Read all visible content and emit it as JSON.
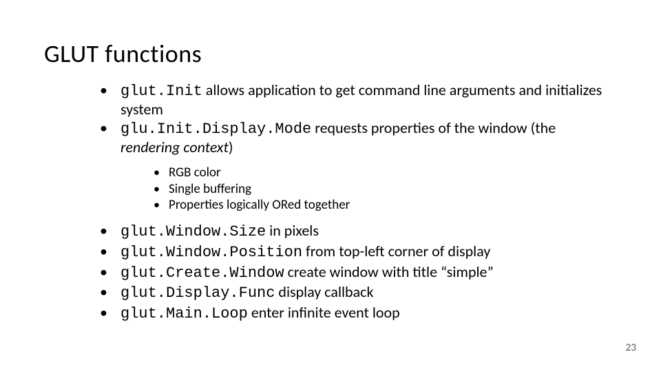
{
  "title": "GLUT functions",
  "items": [
    {
      "code": "glut.Init",
      "text_after": "  allows application to get command line arguments and initializes system"
    },
    {
      "code": "glu.Init.Display.Mode",
      "text_after": "  requests properties of the window (the ",
      "italic": "rendering context",
      "text_end": ")",
      "sub": [
        "RGB color",
        "Single buffering",
        "Properties logically ORed together"
      ]
    },
    {
      "code": "glut.Window.Size",
      "text_after": "  in pixels"
    },
    {
      "code": "glut.Window.Position",
      "text_after": "  from top-left corner of display"
    },
    {
      "code": "glut.Create.Window",
      "text_after": "  create window with title “simple”"
    },
    {
      "code": "glut.Display.Func",
      "text_after": "  display callback"
    },
    {
      "code": "glut.Main.Loop",
      "text_after": "  enter infinite event loop"
    }
  ],
  "page_number": "23"
}
